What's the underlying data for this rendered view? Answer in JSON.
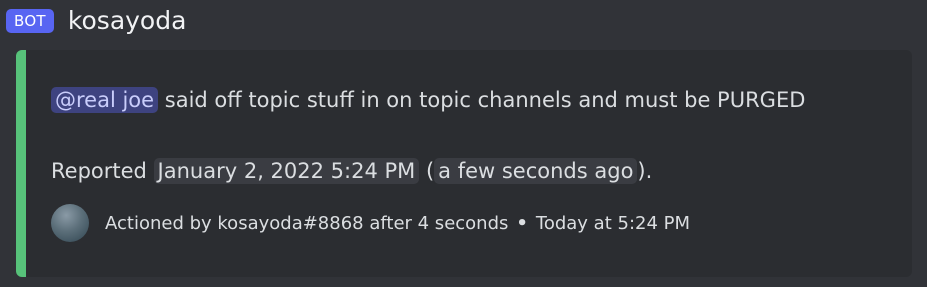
{
  "message": {
    "bot_tag": "BOT",
    "username": "kosayoda"
  },
  "embed": {
    "accent_color": "#57c27a",
    "mention": "@real joe",
    "description_rest": " said off topic stuff in on topic channels and must be PURGED",
    "reported_prefix": "Reported ",
    "reported_timestamp": "January 2, 2022 5:24 PM",
    "paren_open": " (",
    "relative_time": "a few seconds ago",
    "paren_close": ").",
    "footer": {
      "avatar_icon": "user-avatar",
      "text": "Actioned by kosayoda#8868 after 4 seconds",
      "separator": "•",
      "time": "Today at 5:24 PM"
    }
  }
}
